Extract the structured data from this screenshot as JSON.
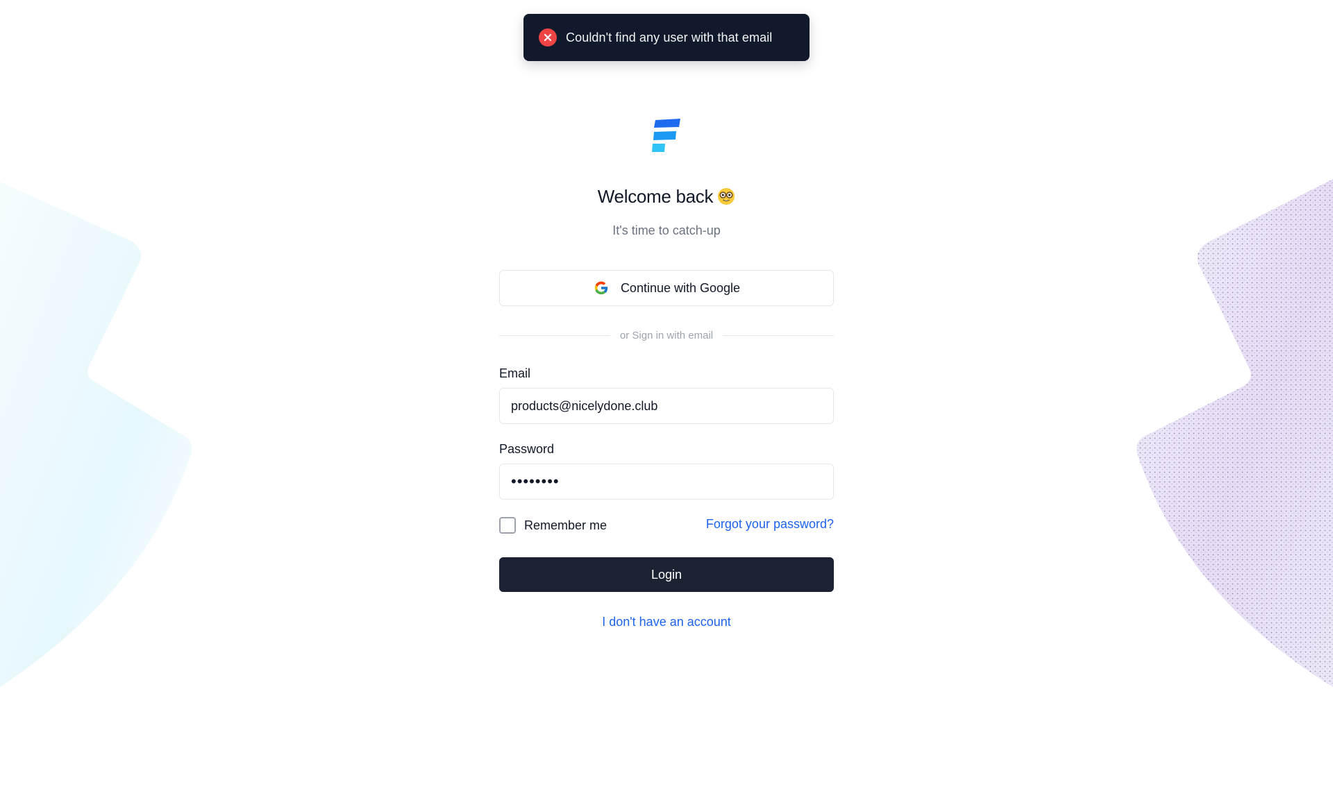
{
  "toast": {
    "message": "Couldn't find any user with that email",
    "icon": "error-x-icon",
    "background": "#111a2c",
    "icon_color": "#ef4444"
  },
  "logo": {
    "icon": "brand-logo-icon",
    "colors": [
      "#1f6bf0",
      "#1c9af3",
      "#2fc3f6"
    ]
  },
  "heading": {
    "title": "Welcome back",
    "emoji": "nerd-face-emoji",
    "subtitle": "It's time to catch-up"
  },
  "google": {
    "label": "Continue with Google",
    "icon": "google-icon"
  },
  "divider": {
    "text": "or Sign in with email"
  },
  "form": {
    "email_label": "Email",
    "email_value": "products@nicelydone.club",
    "password_label": "Password",
    "password_value": "••••••••",
    "remember_label": "Remember me",
    "remember_checked": false,
    "forgot_label": "Forgot your password?",
    "login_label": "Login"
  },
  "footer": {
    "signup_label": "I don't have an account"
  },
  "colors": {
    "link": "#1d63ed",
    "primary_button": "#1b2333"
  }
}
